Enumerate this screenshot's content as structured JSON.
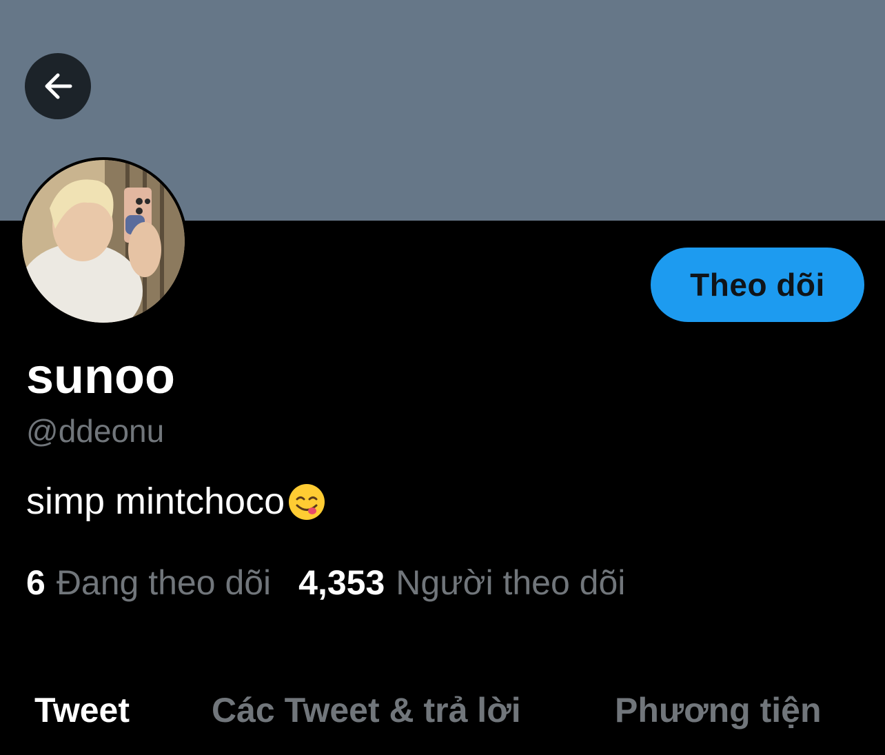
{
  "header": {
    "back_icon": "arrow-left-icon",
    "banner_color": "#667788"
  },
  "profile": {
    "display_name": "sunoo",
    "handle": "@ddeonu",
    "bio_text": "simp mintchoco",
    "bio_emoji": "face-savoring-food-emoji",
    "follow_button_label": "Theo dõi",
    "follow_button_color": "#1d9bf0"
  },
  "stats": {
    "following_count": "6",
    "following_label": "Đang theo dõi",
    "followers_count": "4,353",
    "followers_label": "Người theo dõi"
  },
  "tabs": [
    {
      "label": "Tweet",
      "active": true
    },
    {
      "label": "Các Tweet & trả lời",
      "active": false
    },
    {
      "label": "Phương tiện",
      "active": false
    }
  ]
}
